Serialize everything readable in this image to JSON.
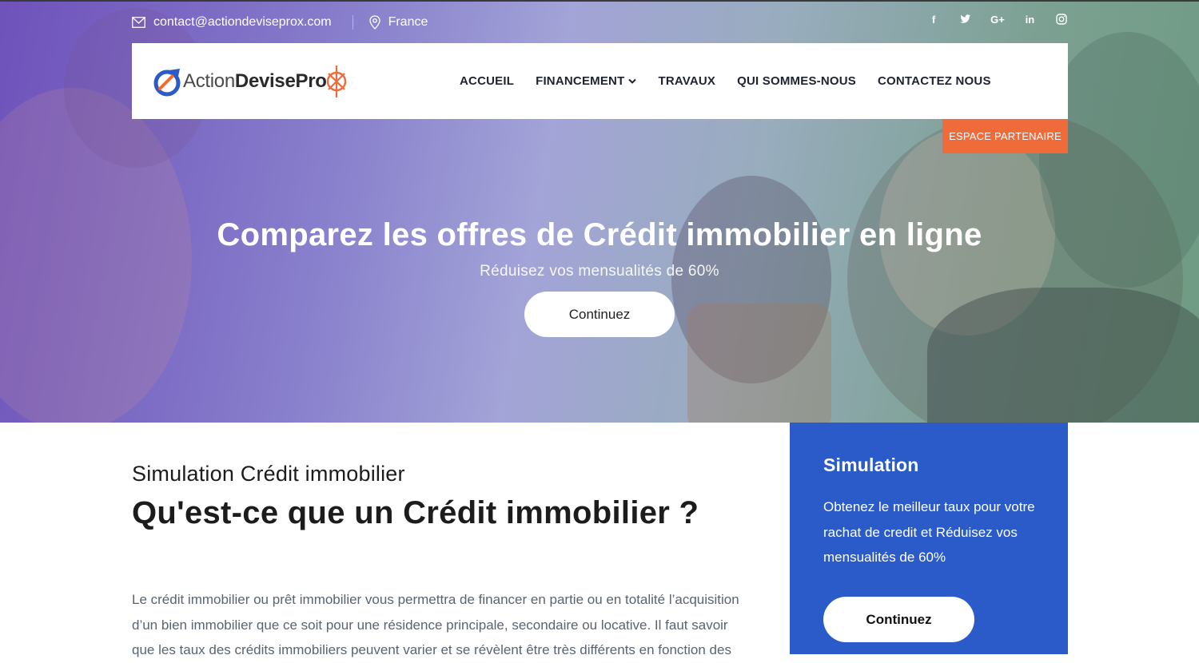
{
  "topbar": {
    "email": "contact@actiondeviseprox.com",
    "location": "France",
    "social": [
      {
        "icon": "facebook-icon",
        "glyph": "f"
      },
      {
        "icon": "twitter-icon",
        "glyph": "🐦"
      },
      {
        "icon": "google-plus-icon",
        "glyph": "G+"
      },
      {
        "icon": "linkedin-icon",
        "glyph": "in"
      },
      {
        "icon": "instagram-icon",
        "glyph": "◎"
      }
    ]
  },
  "logo": {
    "part1": "Action",
    "part2": "DevisePro",
    "colors": {
      "blue": "#2b5bc7",
      "orange": "#ef6b3a"
    }
  },
  "nav": {
    "items": [
      "ACCUEIL",
      "FINANCEMENT",
      "TRAVAUX",
      "QUI SOMMES-NOUS",
      "CONTACTEZ NOUS"
    ],
    "partner": "ESPACE PARTENAIRE"
  },
  "hero": {
    "title": "Comparez les offres de Crédit immobilier en ligne",
    "subtitle": "Réduisez vos mensualités de 60%",
    "button": "Continuez"
  },
  "content": {
    "subheading": "Simulation Crédit immobilier",
    "heading": "Qu'est-ce que un Crédit immobilier ?",
    "paragraph": "Le crédit immobilier ou prêt immobilier vous permettra de financer en partie ou en totalité l’acquisition d’un bien immobilier que ce soit pour une résidence principale, secondaire ou locative. Il faut savoir que les taux des crédits immobiliers peuvent varier et se révèlent être très différents en fonction des"
  },
  "simulation": {
    "title": "Simulation",
    "text": "Obtenez le meilleur taux pour votre rachat de credit et Réduisez vos mensualités de 60%",
    "button": "Continuez"
  },
  "colors": {
    "accent_orange": "#ef6b3a",
    "simulation_blue": "#2a5bc9",
    "text_dark": "#1c1c1c",
    "text_muted": "#5a6470"
  }
}
